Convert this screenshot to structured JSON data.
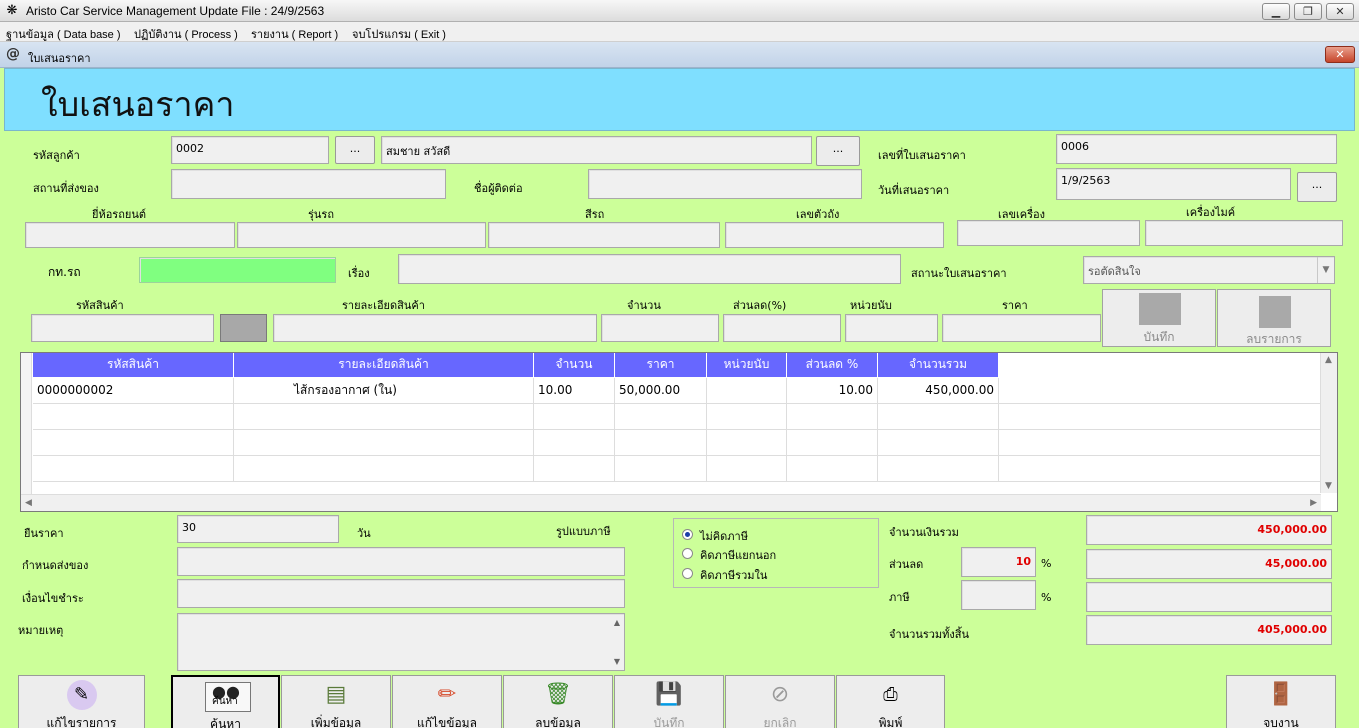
{
  "window": {
    "title": "Aristo Car Service Management   Update File : 24/9/2563"
  },
  "menu": [
    "ฐานข้อมูล ( Data base )",
    "ปฏิบัติงาน ( Process )",
    "รายงาน ( Report )",
    "จบโปรแกรม ( Exit )"
  ],
  "child": {
    "title": "ใบเสนอราคา",
    "icon": "@"
  },
  "form": {
    "heading": "ใบเสนอราคา",
    "customer_code_label": "รหัสลูกค้า",
    "customer_code": "0002",
    "customer_name": "สมชาย สวัสดี",
    "browse": "...",
    "quote_no_label": "เลขที่ใบเสนอราคา",
    "quote_no": "0006",
    "ship_place_label": "สถานที่ส่งของ",
    "ship_place": "",
    "contact_label": "ชื่อผู้ติดต่อ",
    "contact": "",
    "quote_date_label": "วันที่เสนอราคา",
    "quote_date": "1/9/2563",
    "car_brand_label": "ยี่ห้อรถยนต์",
    "car_model_label": "รุ่นรถ",
    "car_color_label": "สีรถ",
    "chassis_label": "เลขตัวถัง",
    "engine_label": "เลขเครื่อง",
    "mileage_label": "เครื่องไมค์",
    "plate_label": "กท.รถ",
    "subject_label": "เรื่อง",
    "quote_status_label": "สถานะใบเสนอราคา",
    "quote_status": "รอตัดสินใจ",
    "item_code_label": "รหัสสินค้า",
    "item_desc_label": "รายละเอียดสินค้า",
    "qty_label": "จำนวน",
    "discount_pct_label": "ส่วนลด(%)",
    "unit_label": "หน่วยนับ",
    "price_label": "ราคา",
    "save_item": "บันทึก",
    "delete_item": "ลบรายการ"
  },
  "grid": {
    "columns": [
      "รหัสสินค้า",
      "รายละเอียดสินค้า",
      "จำนวน",
      "ราคา",
      "หน่วยนับ",
      "ส่วนลด %",
      "จำนวนรวม"
    ],
    "rows": [
      [
        "0000000002",
        "ไส้กรองอากาศ (ใน)",
        "10.00",
        "50,000.00",
        "",
        "10.00",
        "450,000.00"
      ]
    ]
  },
  "footer": {
    "price_valid_label": "ยืนราคา",
    "price_valid": "30",
    "days_label": "วัน",
    "tax_type_label": "รูปแบบภาษี",
    "tax_options": [
      "ไม่คิดภาษี",
      "คิดภาษีแยกนอก",
      "คิดภาษีรวมใน"
    ],
    "tax_selected": 0,
    "delivery_label": "กำหนดส่งของ",
    "payment_label": "เงื่อนไขชำระ",
    "note_label": "หมายเหตุ",
    "total_label": "จำนวนเงินรวม",
    "total": "450,000.00",
    "discount_label": "ส่วนลด",
    "discount_pct": "10",
    "discount_amount": "45,000.00",
    "tax_label": "ภาษี",
    "tax_pct": "",
    "tax_amount": "",
    "pct": "%",
    "grand_total_label": "จำนวนรวมทั้งสิ้น",
    "grand_total": "405,000.00"
  },
  "toolbar": {
    "edit_items": "แก้ไขรายการ",
    "search": "ค้นหา",
    "search_caption": "ค้นหา",
    "add": "เพิ่มข้อมูล",
    "edit": "แก้ไขข้อมูล",
    "delete": "ลบข้อมูล",
    "save": "บันทึก",
    "cancel": "ยกเลิก",
    "print": "พิมพ์",
    "exit": "จบงาน"
  },
  "colors": {
    "form_bg": "#ccff99",
    "banner_bg": "#7fdfff",
    "grid_header": "#6767ff",
    "plate_field": "#80ff80",
    "amount_red": "#e00000"
  }
}
